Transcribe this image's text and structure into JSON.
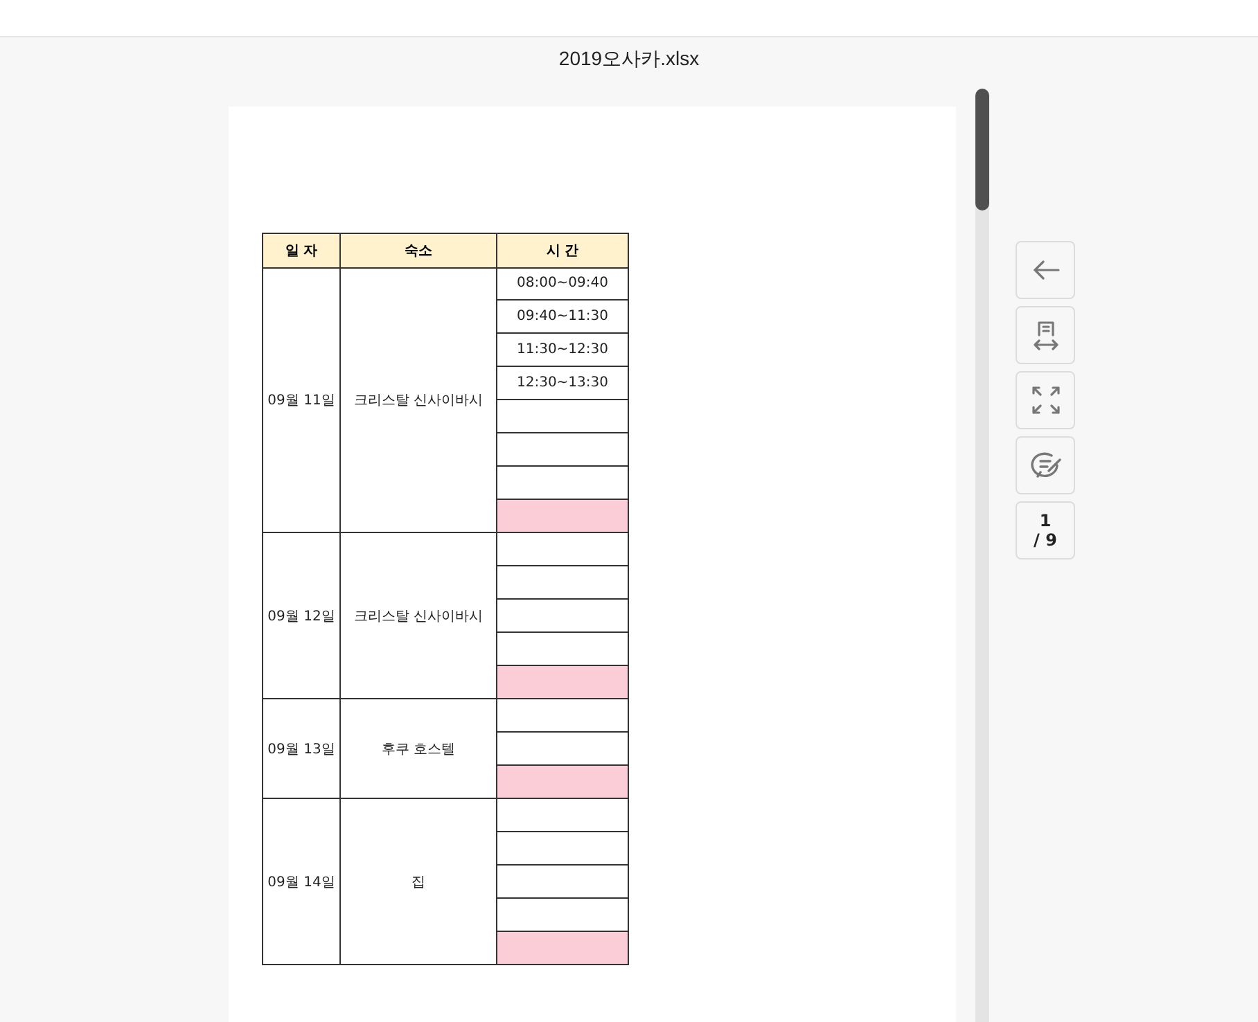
{
  "document": {
    "title": "2019오사카.xlsx"
  },
  "table": {
    "columns": [
      "일 자",
      "숙소",
      "시 간"
    ],
    "groups": [
      {
        "date": "09월 11일",
        "lodging": "크리스탈 신사이바시",
        "slots": [
          {
            "time": "08:00~09:40",
            "highlighted": false
          },
          {
            "time": "09:40~11:30",
            "highlighted": false
          },
          {
            "time": "11:30~12:30",
            "highlighted": false
          },
          {
            "time": "12:30~13:30",
            "highlighted": false
          },
          {
            "highlighted": false
          },
          {
            "highlighted": false
          },
          {
            "highlighted": false
          },
          {
            "highlighted": true
          }
        ]
      },
      {
        "date": "09월 12일",
        "lodging": "크리스탈 신사이바시",
        "slots": [
          {
            "highlighted": false
          },
          {
            "highlighted": false
          },
          {
            "highlighted": false
          },
          {
            "highlighted": false
          },
          {
            "highlighted": true
          }
        ]
      },
      {
        "date": "09월 13일",
        "lodging": "후쿠 호스텔",
        "slots": [
          {
            "highlighted": false
          },
          {
            "highlighted": false
          },
          {
            "highlighted": true
          }
        ]
      },
      {
        "date": "09월 14일",
        "lodging": "집",
        "slots": [
          {
            "highlighted": false
          },
          {
            "highlighted": false
          },
          {
            "highlighted": false
          },
          {
            "highlighted": false
          },
          {
            "highlighted": true
          }
        ]
      }
    ]
  },
  "toolbar": [
    {
      "kind": "back"
    },
    {
      "kind": "fit-width"
    },
    {
      "kind": "fullscreen"
    },
    {
      "kind": "comment"
    }
  ],
  "pager": {
    "current": "1",
    "total": "/ 9"
  }
}
